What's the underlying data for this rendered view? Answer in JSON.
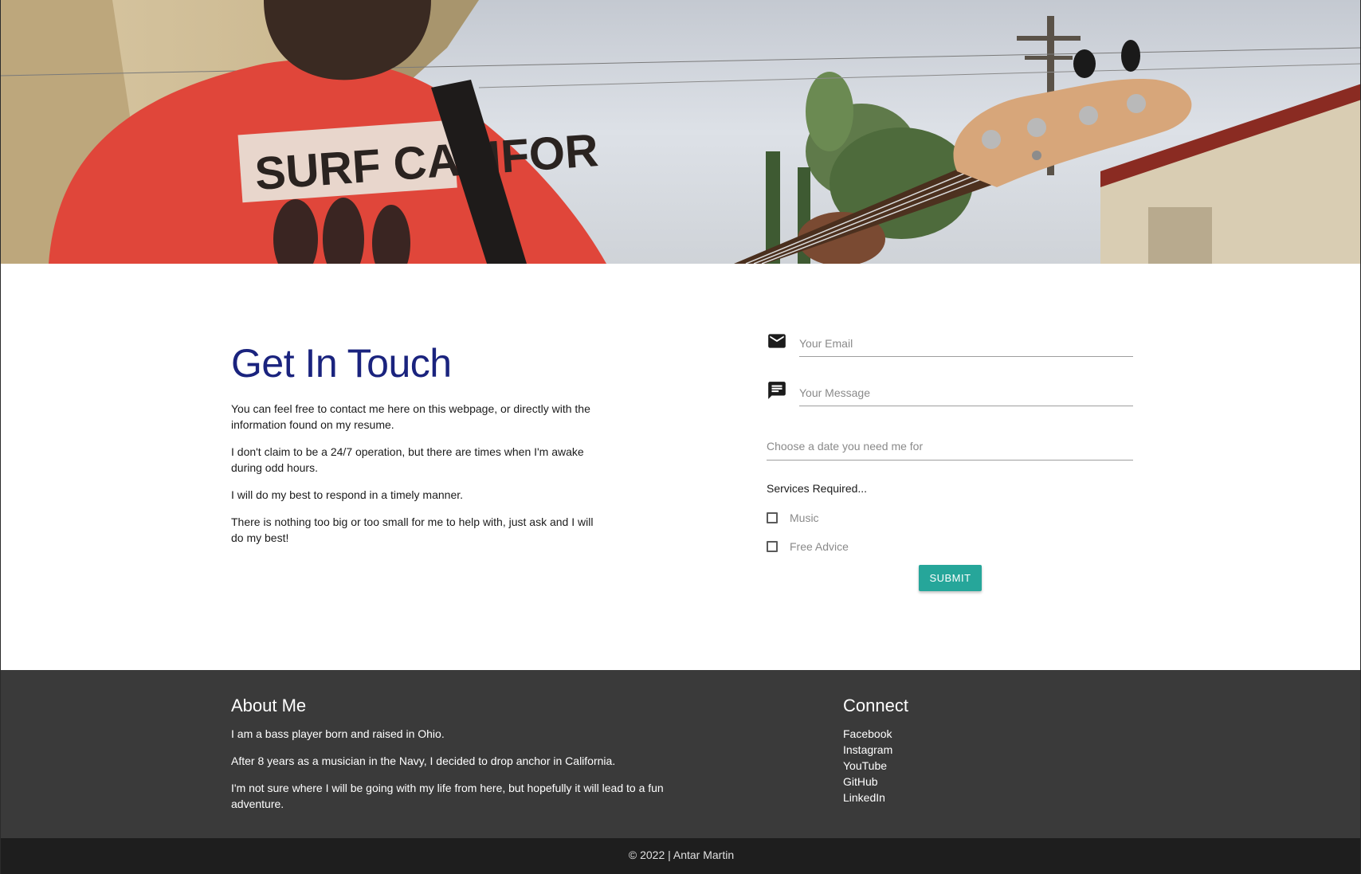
{
  "hero": {
    "shirt_text": "SURF CALIFOR"
  },
  "contact": {
    "title": "Get In Touch",
    "paragraphs": [
      "You can feel free to contact me here on this webpage, or directly with the information found on my resume.",
      "I don't claim to be a 24/7 operation, but there are times when I'm awake during odd hours.",
      "I will do my best to respond in a timely manner.",
      "There is nothing too big or too small for me to help with, just ask and I will do my best!"
    ]
  },
  "form": {
    "email_placeholder": "Your Email",
    "message_placeholder": "Your Message",
    "date_placeholder": "Choose a date you need me for",
    "services_label": "Services Required...",
    "services": [
      {
        "label": "Music",
        "checked": false
      },
      {
        "label": "Free Advice",
        "checked": false
      }
    ],
    "submit_label": "SUBMIT",
    "email_icon": "mail-icon",
    "message_icon": "message-icon"
  },
  "footer": {
    "about": {
      "title": "About Me",
      "paragraphs": [
        "I am a bass player born and raised in Ohio.",
        "After 8 years as a musician in the Navy, I decided to drop anchor in California.",
        "I'm not sure where I will be going with my life from here, but hopefully it will lead to a fun adventure."
      ]
    },
    "connect": {
      "title": "Connect",
      "links": [
        "Facebook",
        "Instagram",
        "YouTube",
        "GitHub",
        "LinkedIn"
      ]
    },
    "copyright": "© 2022 | Antar Martin"
  },
  "colors": {
    "title_blue": "#1a237e",
    "submit_teal": "#26a69a",
    "footer_bg": "#3a3a3a",
    "copyright_bg": "#1e1e1e"
  }
}
